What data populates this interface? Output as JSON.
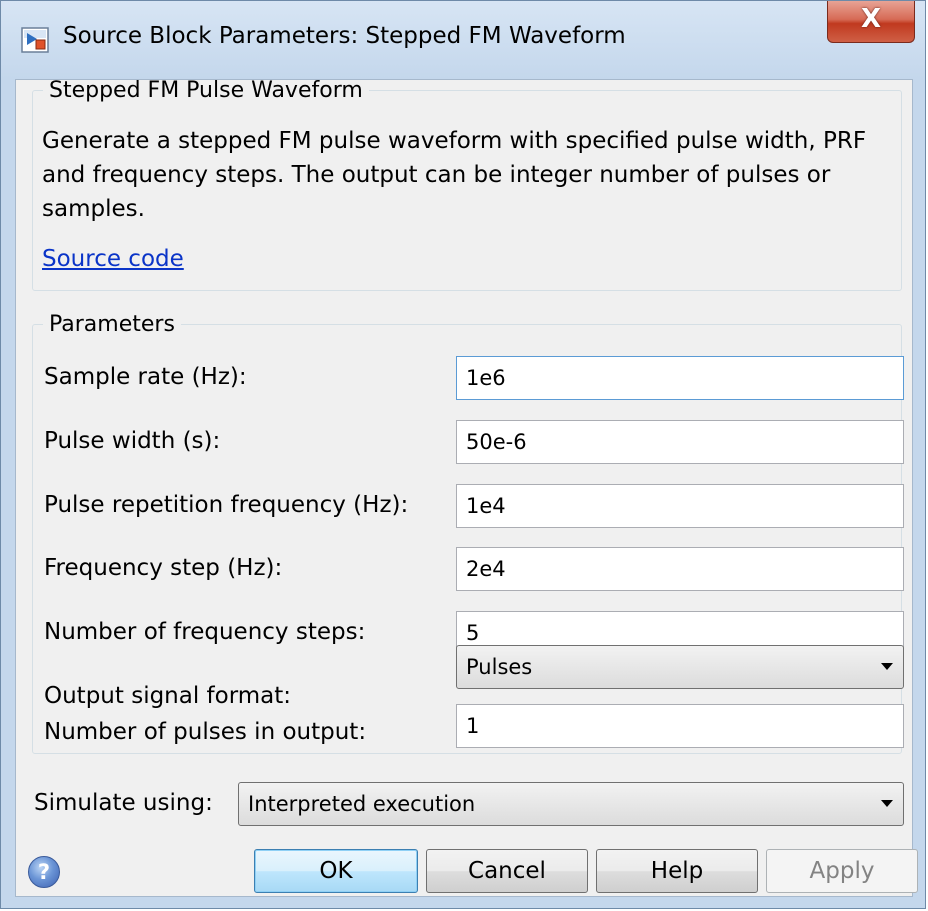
{
  "window": {
    "title": "Source Block Parameters: Stepped FM Waveform",
    "close_glyph": "X"
  },
  "description": {
    "group_title": "Stepped FM Pulse Waveform",
    "text": "Generate a stepped FM pulse waveform with specified pulse width, PRF and frequency steps. The output can be integer number of pulses or samples.",
    "link": "Source code"
  },
  "parameters": {
    "group_title": "Parameters",
    "fields": [
      {
        "label": "Sample rate (Hz):",
        "value": "1e6"
      },
      {
        "label": "Pulse width (s):",
        "value": "50e-6"
      },
      {
        "label": "Pulse repetition frequency (Hz):",
        "value": "1e4"
      },
      {
        "label": "Frequency step (Hz):",
        "value": "2e4"
      },
      {
        "label": "Number of frequency steps:",
        "value": "5"
      },
      {
        "label": "Output signal format:",
        "value": "Pulses"
      },
      {
        "label": "Number of pulses in output:",
        "value": "1"
      }
    ]
  },
  "simulate": {
    "label": "Simulate using:",
    "value": "Interpreted execution"
  },
  "buttons": {
    "help_icon_glyph": "?",
    "ok": "OK",
    "cancel": "Cancel",
    "help": "Help",
    "apply": "Apply"
  },
  "colors": {
    "frame": "#c4d7ec",
    "link": "#0a34c8",
    "close_button": "#c0391f",
    "default_button": "#bee6fd"
  }
}
